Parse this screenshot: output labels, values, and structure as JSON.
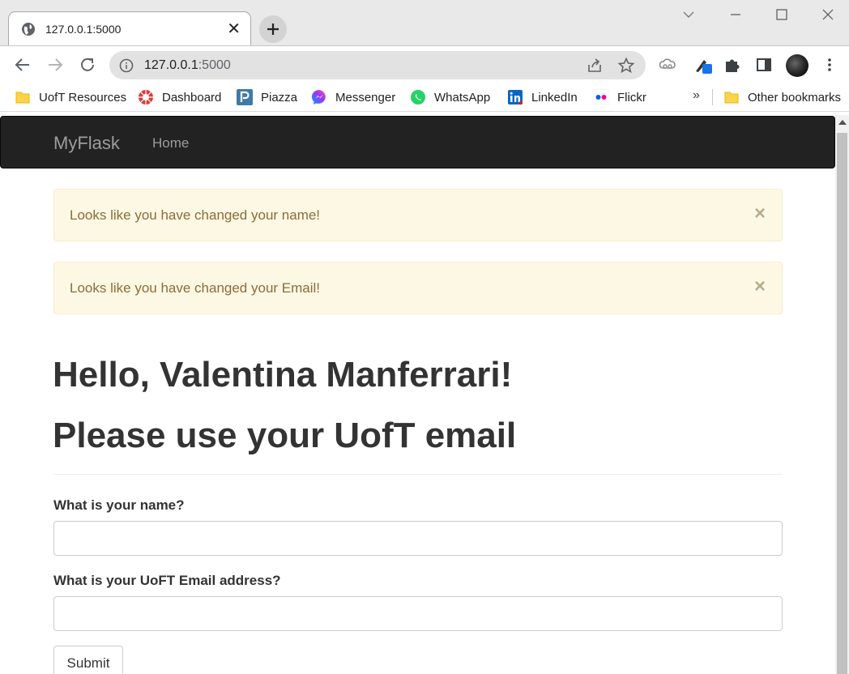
{
  "browser": {
    "tab": {
      "title": "127.0.0.1:5000",
      "favicon": "globe-icon",
      "close": "✕"
    },
    "address_bar": {
      "host": "127.0.0.1",
      "port": ":5000"
    },
    "bookmarks": [
      {
        "label": "UofT Resources",
        "icon": "folder-icon"
      },
      {
        "label": "Dashboard",
        "icon": "dashboard-icon"
      },
      {
        "label": "Piazza",
        "icon": "piazza-icon"
      },
      {
        "label": "Messenger",
        "icon": "messenger-icon"
      },
      {
        "label": "WhatsApp",
        "icon": "whatsapp-icon"
      },
      {
        "label": "LinkedIn",
        "icon": "linkedin-icon"
      },
      {
        "label": "Flickr",
        "icon": "flickr-icon"
      }
    ],
    "bookmarks_overflow": "»",
    "other_bookmarks": "Other bookmarks"
  },
  "navbar": {
    "brand": "MyFlask",
    "links": [
      "Home"
    ]
  },
  "alerts": [
    {
      "text": "Looks like you have changed your name!",
      "close": "×"
    },
    {
      "text": "Looks like you have changed your Email!",
      "close": "×"
    }
  ],
  "page": {
    "greeting": "Hello, Valentina Manferrari!",
    "subheading": "Please use your UofT email"
  },
  "form": {
    "name_label": "What is your name?",
    "name_value": "",
    "email_label": "What is your UoFT Email address?",
    "email_value": "",
    "submit_label": "Submit"
  },
  "colors": {
    "navbar_bg": "#222222",
    "navbar_text": "#9d9d9d",
    "alert_bg": "#fcf8e3",
    "alert_border": "#faebcc",
    "alert_text": "#8a6d3b"
  }
}
